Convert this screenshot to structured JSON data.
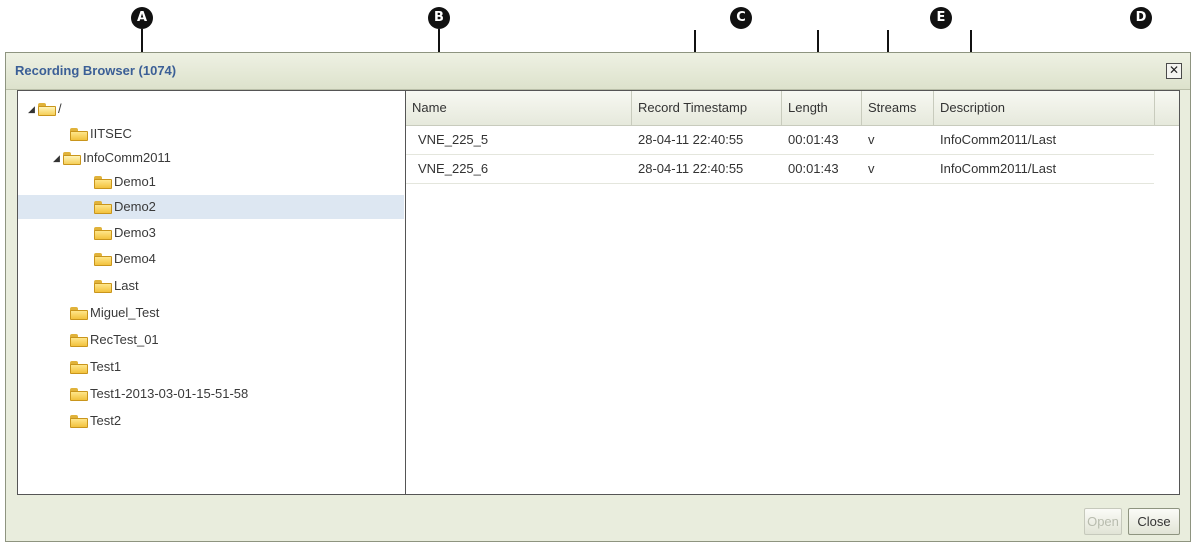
{
  "callouts": {
    "a": "A",
    "b": "B",
    "c": "C",
    "d": "D",
    "e": "E"
  },
  "window": {
    "title": "Recording Browser (1074)",
    "close_glyph": "✕"
  },
  "tree": {
    "items": [
      {
        "label": "/",
        "expanded": true
      },
      {
        "label": "IITSEC"
      },
      {
        "label": "InfoComm2011",
        "expanded": true
      },
      {
        "label": "Demo1"
      },
      {
        "label": "Demo2",
        "selected": true
      },
      {
        "label": "Demo3"
      },
      {
        "label": "Demo4"
      },
      {
        "label": "Last"
      },
      {
        "label": "Miguel_Test"
      },
      {
        "label": "RecTest_01"
      },
      {
        "label": "Test1"
      },
      {
        "label": "Test1-2013-03-01-15-51-58"
      },
      {
        "label": "Test2"
      }
    ],
    "expand_glyph": "◢"
  },
  "grid": {
    "columns": [
      "Name",
      "Record Timestamp",
      "Length",
      "Streams",
      "Description"
    ],
    "rows": [
      [
        "VNE_225_5",
        "28-04-11 22:40:55",
        "00:01:43",
        "v",
        "InfoComm2011/Last"
      ],
      [
        "VNE_225_6",
        "28-04-11 22:40:55",
        "00:01:43",
        "v",
        "InfoComm2011/Last"
      ]
    ]
  },
  "buttons": {
    "open": "Open",
    "close": "Close"
  },
  "colors": {
    "title_text": "#3b5f96",
    "selected_row": "#dde7f2",
    "folder": "#f2c23d"
  }
}
